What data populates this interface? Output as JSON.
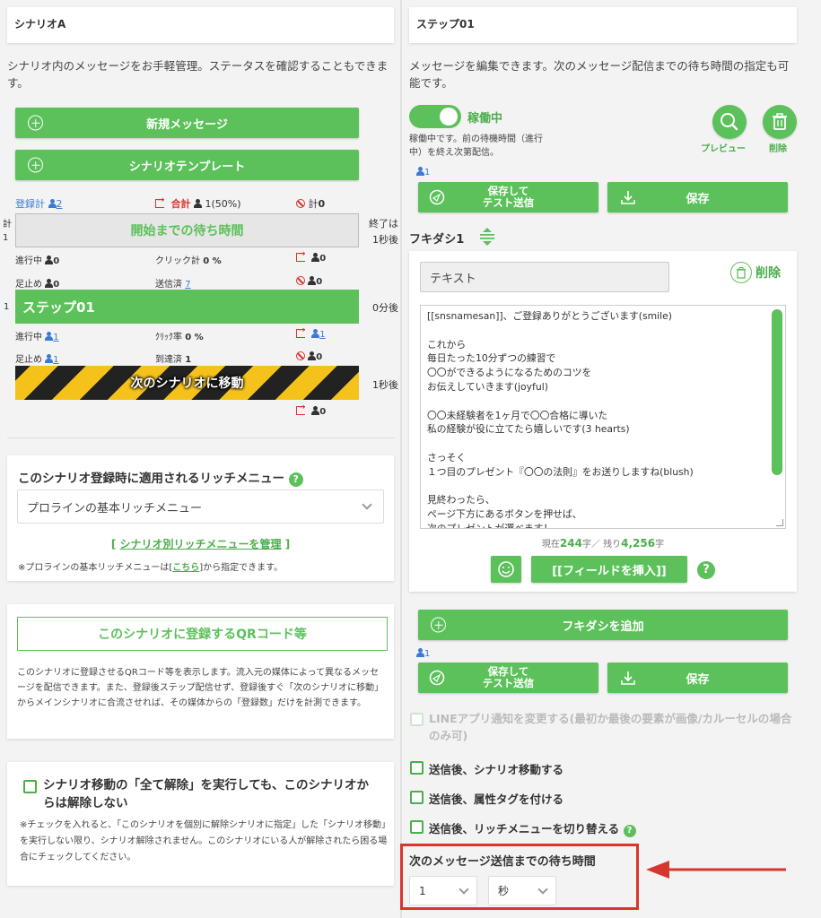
{
  "left": {
    "scenario_name_value": "シナリオA",
    "description": "シナリオ内のメッセージをお手軽管理。ステータスを確認することもできます。",
    "new_message_label": "新規メッセージ",
    "scenario_template_label": "シナリオテンプレート",
    "stats1": {
      "registered_label": "登録計",
      "registered_count": "2",
      "total_label": "合計",
      "total_value": "1(50%)",
      "total2_label": "計",
      "total2_value": "0"
    },
    "wait_block": {
      "left_label1": "計",
      "left_label2": "1",
      "title": "開始までの待ち時間",
      "right_label1": "終了は",
      "right_label2": "1秒後"
    },
    "stats2": {
      "in_progress_label": "進行中",
      "in_progress_value": "0",
      "click_label": "クリック計",
      "click_value": "0 %",
      "exit_value": "0",
      "stopped_label": "足止め",
      "stopped_value": "0",
      "sent_label": "送信済",
      "sent_value": "7",
      "ban_value": "0"
    },
    "step_block": {
      "left_label": "1",
      "title": "ステップ01",
      "right_label": "0分後"
    },
    "stats3": {
      "in_progress_label": "進行中",
      "in_progress_value": "1",
      "click_label": "ｸﾘｯｸ率",
      "click_value": "0 %",
      "exit_value": "1",
      "stopped_label": "足止め",
      "stopped_value": "1",
      "reached_label": "到達済",
      "reached_value": "1",
      "ban_value": "0"
    },
    "next_block": {
      "title": "次のシナリオに移動",
      "right_label": "1秒後",
      "exit_value": "0"
    },
    "rich_menu": {
      "title": "このシナリオ登録時に適用されるリッチメニュー",
      "selected": "プロラインの基本リッチメニュー",
      "manage_open": "[",
      "manage_link": "シナリオ別リッチメニューを管理",
      "manage_close": "]",
      "note_prefix": "※プロラインの基本リッチメニューは[",
      "note_link": "こちら",
      "note_suffix": "]から指定できます。"
    },
    "qr": {
      "button_label": "このシナリオに登録するQRコード等",
      "description": "このシナリオに登録させるQRコード等を表示します。流入元の媒体によって異なるメッセージを配信できます。また、登録後ステップ配信せず、登録後すぐ「次のシナリオに移動」からメインシナリオに合流させれば、その媒体からの「登録数」だけを計測できます。"
    },
    "release": {
      "title": "シナリオ移動の「全て解除」を実行しても、このシナリオからは解除しない",
      "note": "※チェックを入れると、「このシナリオを個別に解除シナリオに指定」した「シナリオ移動」を実行しない限り、シナリオ解除されません。このシナリオにいる人が解除されたら困る場合にチェックしてください。"
    }
  },
  "right": {
    "step_name_value": "ステップ01",
    "description": "メッセージを編集できます。次のメッセージ配信までの待ち時間の指定も可能です。",
    "toggle_label": "稼働中",
    "toggle_desc": "稼働中です。前の待機時間（進行中）を終え次第配信。",
    "preview_label": "プレビュー",
    "delete_label": "削除",
    "user_count": "1",
    "save_test_label": "保存して\nテスト送信",
    "save_label": "保存",
    "bubble_title": "フキダシ1",
    "bubble_type": "テキスト",
    "bubble_delete": "削除",
    "message_text": "[[snsnamesan]]、ご登録ありがとうございます(smile)\n\nこれから\n毎日たった10分ずつの練習で\n〇〇ができるようになるためのコツを\nお伝えしていきます(joyful)\n\n〇〇未経験者を1ヶ月で〇〇合格に導いた\n私の経験が役に立てたら嬉しいです(3 hearts)\n\nさっそく\n１つ目のプレゼント『〇〇の法則』をお送りしますね(blush)\n\n見終わったら、\nページ下方にあるボタンを押せば、\n次のプレゼントが選べます！",
    "char_count_prefix": "現在",
    "char_count": "244",
    "char_count_mid": "字／ 残り",
    "char_remaining": "4,256",
    "char_count_suffix": "字",
    "insert_field_label": "[[フィールドを挿入]]",
    "add_bubble_label": "フキダシを追加",
    "user_count2": "1",
    "line_notify_label": "LINEアプリ通知を変更する(最初か最後の要素が画像/カルーセルの場合のみ可)",
    "after_send_scenario": "送信後、シナリオ移動する",
    "after_send_tag": "送信後、属性タグを付ける",
    "after_send_richmenu": "送信後、リッチメニューを切り替える",
    "wait_title": "次のメッセージ送信までの待ち時間",
    "wait_value": "1",
    "wait_unit": "秒"
  },
  "colors": {
    "accent_green": "#5cc15a",
    "alert_red": "#d9352f",
    "link_blue": "#3b7bd6"
  }
}
